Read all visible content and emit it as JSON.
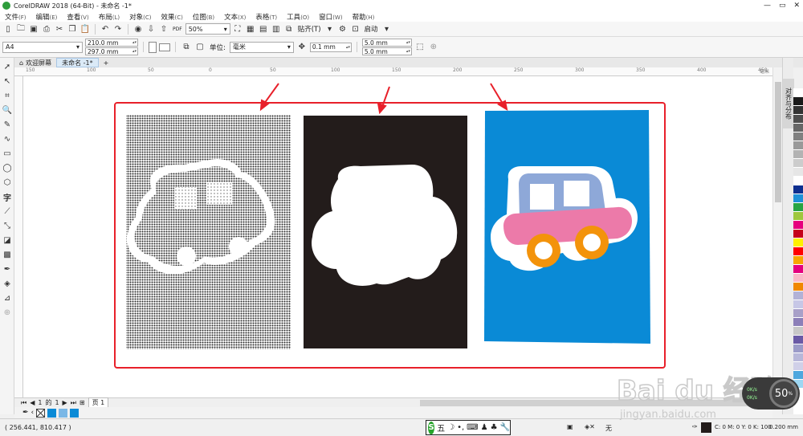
{
  "titlebar": {
    "title": "CorelDRAW 2018 (64-Bit) - 未命名 -1*",
    "min": "—",
    "restore": "▭",
    "close": "✕"
  },
  "menu": [
    {
      "label": "文件",
      "acc": "(F)"
    },
    {
      "label": "编辑",
      "acc": "(E)"
    },
    {
      "label": "查看",
      "acc": "(V)"
    },
    {
      "label": "布局",
      "acc": "(L)"
    },
    {
      "label": "对象",
      "acc": "(C)"
    },
    {
      "label": "效果",
      "acc": "(C)"
    },
    {
      "label": "位图",
      "acc": "(B)"
    },
    {
      "label": "文本",
      "acc": "(X)"
    },
    {
      "label": "表格",
      "acc": "(T)"
    },
    {
      "label": "工具",
      "acc": "(O)"
    },
    {
      "label": "窗口",
      "acc": "(W)"
    },
    {
      "label": "帮助",
      "acc": "(H)"
    }
  ],
  "stdbar": {
    "zoom": "50%",
    "snap_label": "贴齐(T)",
    "launch_label": "启动",
    "pdf_label": "PDF"
  },
  "propbar": {
    "page_size": "A4",
    "width": "210.0 mm",
    "height": "297.0 mm",
    "units_label": "单位:",
    "units_value": "毫米",
    "nudge": "0.1 mm",
    "dup_x": "5.0 mm",
    "dup_y": "5.0 mm"
  },
  "doctabs": {
    "welcome": "欢迎屏幕",
    "doc": "未命名 -1*",
    "add": "+"
  },
  "ruler": {
    "labels": [
      "150",
      "100",
      "50",
      "0",
      "50",
      "100",
      "150",
      "200",
      "250",
      "300",
      "350",
      "400",
      "450"
    ],
    "unit": "毫米"
  },
  "docker": {
    "tab_label": "对齐与分布"
  },
  "pagebar": {
    "current": "1",
    "of": "的",
    "total": "1",
    "page_tab": "页 1"
  },
  "statusbar": {
    "coords": "( 256.441, 810.417 )",
    "fill_label": "无",
    "color_readout": "C: 0 M: 0 Y: 0 K: 100",
    "outline_width": "0.200 mm"
  },
  "ime": {
    "logo": "S",
    "mode": "五"
  },
  "perf": {
    "value": "50",
    "unit": "%",
    "up": "0K/s",
    "down": "0K/s"
  },
  "watermark": {
    "brand": "Bai du 经验",
    "url": "jingyan.baidu.com"
  },
  "palette": [
    "#ffffff",
    "#1a1a1a",
    "#333333",
    "#4d4d4d",
    "#666666",
    "#808080",
    "#999999",
    "#b3b3b3",
    "#cccccc",
    "#e6e6e6",
    "#ffffff",
    "#0d2f8f",
    "#1e90d8",
    "#27a443",
    "#9ec73d",
    "#e6007e",
    "#c5001a",
    "#fff000",
    "#ff0000",
    "#f7a600",
    "#e4007f",
    "#f9b9c8",
    "#f08800",
    "#b2b2d6",
    "#c7c7e6",
    "#a8a0c8",
    "#8c7fb8",
    "#c8c8c8",
    "#6a5aa6",
    "#9b9bc8",
    "#b7b7d9",
    "#d0d0e8",
    "#4fa8de",
    "#9ed7f2",
    "#ffffff"
  ],
  "colors": {
    "arrow": "#e8202a",
    "frame": "#e8202a",
    "blue_bg": "#0a8ad6",
    "car_pink": "#ec7aa9",
    "car_top": "#8ea8d8",
    "wheel": "#f3930b"
  }
}
